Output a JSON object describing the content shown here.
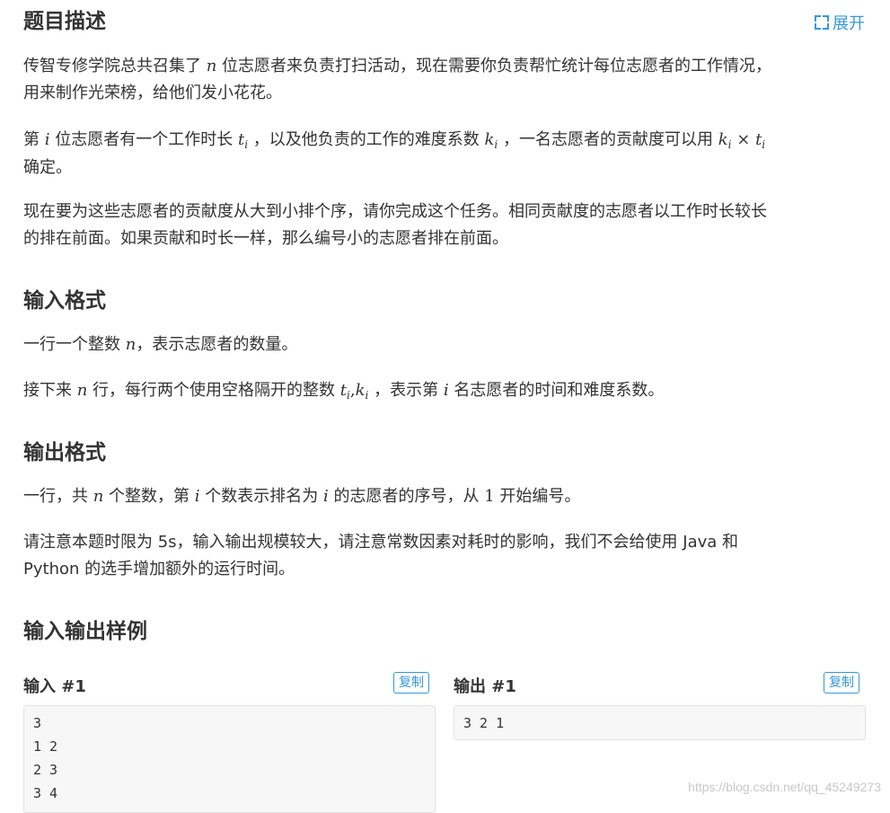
{
  "header": {
    "title": "题目描述",
    "expand_label": "展开"
  },
  "description": {
    "p1_a": "传智专修学院总共召集了 ",
    "p1_n": "n",
    "p1_b": " 位志愿者来负责打扫活动，现在需要你负责帮忙统计每位志愿者的工作情况，",
    "p1_line2": "用来制作光荣榜，给他们发小花花。",
    "p2_a": "第 ",
    "p2_i": "i",
    "p2_b": " 位志愿者有一个工作时长 ",
    "p2_t": "t",
    "p2_sub": "i",
    "p2_c": "，以及他负责的工作的难度系数 ",
    "p2_k": "k",
    "p2_d": "，一名志愿者的贡献度可以用 ",
    "p2_formula_k": "k",
    "p2_times": "×",
    "p2_formula_t": "t",
    "p2_line2": "确定。",
    "p3_line1": "现在要为这些志愿者的贡献度从大到小排个序，请你完成这个任务。相同贡献度的志愿者以工作时长较长",
    "p3_line2": "的排在前面。如果贡献和时长一样，那么编号小的志愿者排在前面。"
  },
  "input_format": {
    "title": "输入格式",
    "p1_a": "一行一个整数 ",
    "p1_n": "n",
    "p1_b": "，表示志愿者的数量。",
    "p2_a": "接下来 ",
    "p2_n": "n",
    "p2_b": " 行，每行两个使用空格隔开的整数 ",
    "p2_t": "t",
    "p2_comma": ",",
    "p2_k": "k",
    "p2_c": "，表示第 ",
    "p2_i": "i",
    "p2_d": " 名志愿者的时间和难度系数。"
  },
  "output_format": {
    "title": "输出格式",
    "p1_a": "一行，共 ",
    "p1_n": "n",
    "p1_b": " 个整数，第 ",
    "p1_i": "i",
    "p1_c": " 个数表示排名为 ",
    "p1_i2": "i",
    "p1_d": " 的志愿者的序号，从 ",
    "p1_one": "1",
    "p1_e": " 开始编号。",
    "p2_line1": "请注意本题时限为 5s，输入输出规模较大，请注意常数因素对耗时的影响，我们不会给使用 Java 和",
    "p2_line2": "Python 的选手增加额外的运行时间。"
  },
  "samples": {
    "title": "输入输出样例",
    "input_label": "输入 #1",
    "output_label": "输出 #1",
    "copy_label": "复制",
    "input_lines": [
      "3",
      "1 2",
      "2 3",
      "3 4"
    ],
    "output_lines": [
      "3 2 1"
    ]
  },
  "watermark": "https://blog.csdn.net/qq_45249273"
}
